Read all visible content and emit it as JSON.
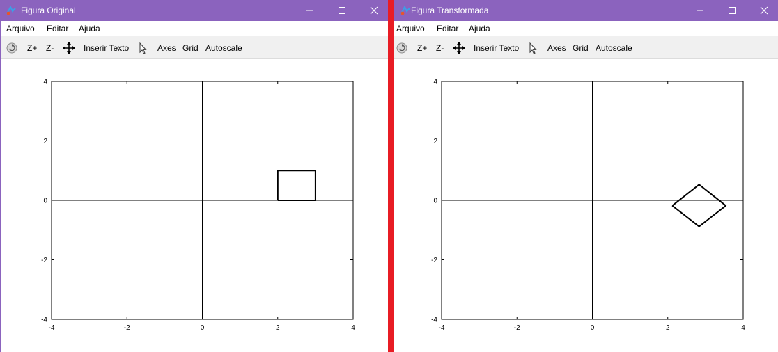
{
  "windows": [
    {
      "title": "Figura Original",
      "menu": [
        "Arquivo",
        "Editar",
        "Ajuda"
      ],
      "toolbar": {
        "zoom_in": "Z+",
        "zoom_out": "Z-",
        "insert_text": "Inserir Texto",
        "axes": "Axes",
        "grid": "Grid",
        "autoscale": "Autoscale"
      },
      "icons": {
        "app": "figure-icon",
        "rotate": "rotate-icon",
        "pan": "pan-arrows-icon",
        "select": "cursor-arrow-icon"
      },
      "chart_data": {
        "type": "line",
        "xlim": [
          -4,
          4
        ],
        "ylim": [
          -4,
          4
        ],
        "xticks": [
          -4,
          -2,
          0,
          2,
          4
        ],
        "yticks": [
          -4,
          -2,
          0,
          2,
          4
        ],
        "axes_lines": true,
        "grid": false,
        "series": [
          {
            "x": [
              2,
              3,
              3,
              2,
              2
            ],
            "y": [
              0,
              0,
              1,
              1,
              0
            ],
            "color": "#000000"
          }
        ]
      }
    },
    {
      "title": "Figura Transformada",
      "menu": [
        "Arquivo",
        "Editar",
        "Ajuda"
      ],
      "toolbar": {
        "zoom_in": "Z+",
        "zoom_out": "Z-",
        "insert_text": "Inserir Texto",
        "axes": "Axes",
        "grid": "Grid",
        "autoscale": "Autoscale"
      },
      "icons": {
        "app": "figure-icon",
        "rotate": "rotate-icon",
        "pan": "pan-arrows-icon",
        "select": "cursor-arrow-icon"
      },
      "chart_data": {
        "type": "line",
        "xlim": [
          -4,
          4
        ],
        "ylim": [
          -4,
          4
        ],
        "xticks": [
          -4,
          -2,
          0,
          2,
          4
        ],
        "yticks": [
          -4,
          -2,
          0,
          2,
          4
        ],
        "axes_lines": true,
        "grid": false,
        "series": [
          {
            "x": [
              2.12,
              2.83,
              3.54,
              2.83,
              2.12
            ],
            "y": [
              -0.18,
              -0.88,
              -0.18,
              0.53,
              -0.18
            ],
            "color": "#000000"
          }
        ]
      }
    }
  ],
  "colors": {
    "titlebar": "#8b63be",
    "separator": "#e81c24",
    "toolbar": "#f0f0f0",
    "plot_line": "#000000"
  }
}
